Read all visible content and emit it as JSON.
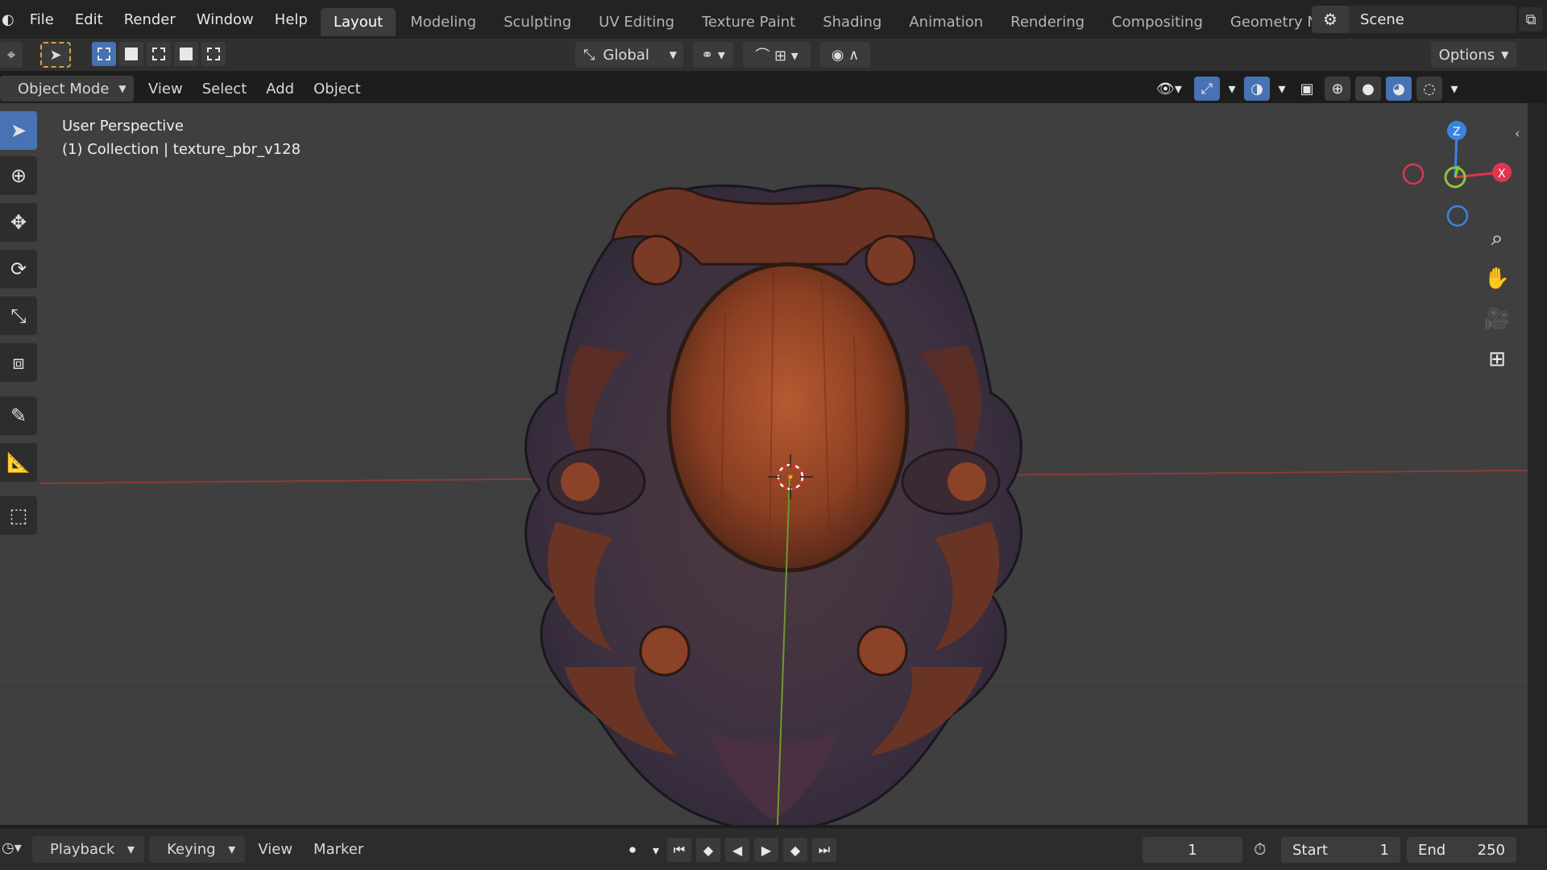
{
  "topbar": {
    "menu": [
      "File",
      "Edit",
      "Render",
      "Window",
      "Help"
    ],
    "workspaces": [
      "Layout",
      "Modeling",
      "Sculpting",
      "UV Editing",
      "Texture Paint",
      "Shading",
      "Animation",
      "Rendering",
      "Compositing",
      "Geometry Nod"
    ],
    "active_workspace": "Layout",
    "scene_label": "Scene"
  },
  "tool_header": {
    "orientation": "Global",
    "options_label": "Options"
  },
  "viewport_header": {
    "mode": "Object Mode",
    "menus": [
      "View",
      "Select",
      "Add",
      "Object"
    ]
  },
  "viewport": {
    "view_name": "User Perspective",
    "collection_info": "(1) Collection | texture_pbr_v128",
    "gizmo": {
      "z": "Z",
      "x": "X"
    }
  },
  "timeline": {
    "menus": [
      "Playback",
      "Keying",
      "View",
      "Marker"
    ],
    "current_frame": "1",
    "start_label": "Start",
    "start_value": "1",
    "end_label": "End",
    "end_value": "250"
  },
  "colors": {
    "accent": "#4772b3",
    "x_axis": "#e0344f",
    "y_axis": "#8bc53f",
    "z_axis": "#3a84e0"
  }
}
